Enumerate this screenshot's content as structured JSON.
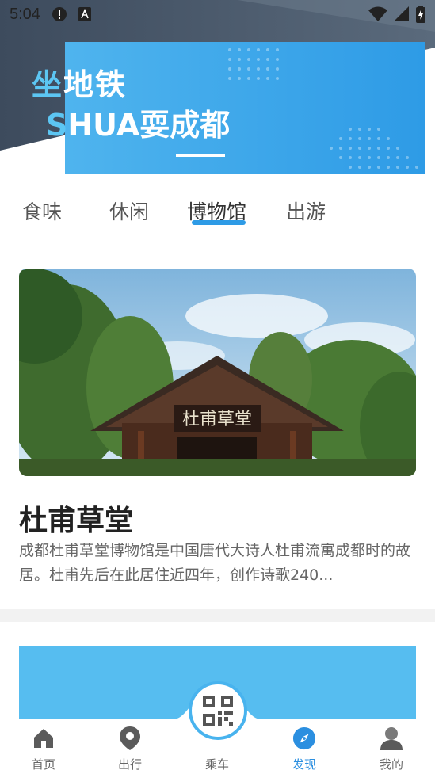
{
  "status_bar": {
    "time": "5:04"
  },
  "banner": {
    "line1_first": "坐",
    "line1_rest": "地铁",
    "line2_first": "S",
    "line2_rest": "HUA耍成都"
  },
  "tabs": [
    {
      "label": "食味",
      "active": false
    },
    {
      "label": "休闲",
      "active": false
    },
    {
      "label": "博物馆",
      "active": true
    },
    {
      "label": "出游",
      "active": false
    }
  ],
  "card": {
    "title": "杜甫草堂",
    "description": "成都杜甫草堂博物馆是中国唐代大诗人杜甫流寓成都时的故居。杜甫先后在此居住近四年，创作诗歌240...",
    "plaque_text": "杜甫草堂"
  },
  "bottom_nav": {
    "items": [
      {
        "label": "首页",
        "icon": "home-icon"
      },
      {
        "label": "出行",
        "icon": "location-pin-icon"
      },
      {
        "label": "乘车",
        "icon": "qr-code-icon"
      },
      {
        "label": "发现",
        "icon": "compass-icon",
        "active": true
      },
      {
        "label": "我的",
        "icon": "user-icon"
      }
    ]
  },
  "colors": {
    "accent": "#2e9be6",
    "banner_light": "#4fb4ee",
    "dark_band": "#3b4a5c"
  }
}
